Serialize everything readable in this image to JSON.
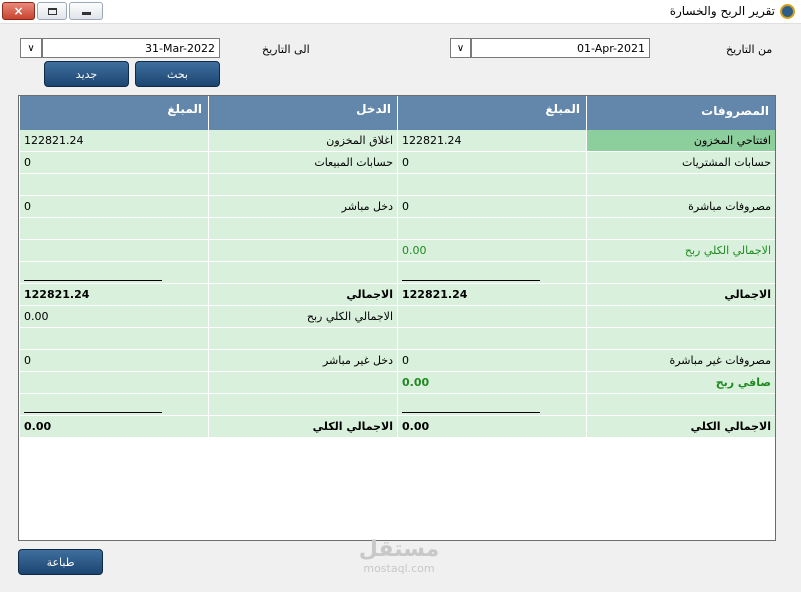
{
  "window": {
    "title": "تقرير الربح والخسارة",
    "close_glyph": "×"
  },
  "filters": {
    "from_label": "من التاريخ",
    "from_value": "01-Apr-2021",
    "to_label": "الى التاريخ",
    "to_value": "31-Mar-2022",
    "from_chevron": "∨",
    "to_chevron": "∨"
  },
  "buttons": {
    "search": "بحث",
    "new": "جديد",
    "print": "طباعة"
  },
  "table": {
    "headers": [
      "المصروفات",
      "المبلغ",
      "الدخل",
      "المبلغ"
    ],
    "rows": [
      [
        "افتتاحي المخزون",
        "122821.24",
        "اغلاق المخزون",
        "122821.24"
      ],
      [
        "حسابات المشتريات",
        "0",
        "حسابات المبيعات",
        "0"
      ],
      [
        "",
        "",
        "",
        ""
      ],
      [
        "مصروفات مباشرة",
        "0",
        "دخل مباشر",
        "0"
      ],
      [
        "",
        "",
        "",
        ""
      ],
      [
        "الاجمالي الكلي ربح",
        "0.00",
        "",
        ""
      ],
      [
        "",
        "",
        "",
        ""
      ],
      [
        "الاجمالي",
        "122821.24",
        "الاجمالي",
        "122821.24"
      ],
      [
        "",
        "",
        "الاجمالي الكلي ربح",
        "0.00"
      ],
      [
        "",
        "",
        "",
        ""
      ],
      [
        "مصروفات غير مباشرة",
        "0",
        "دخل غير مباشر",
        "0"
      ],
      [
        "صافي ربح",
        "0.00",
        "",
        ""
      ],
      [
        "",
        "",
        "",
        ""
      ],
      [
        "الاجمالي الكلي",
        "0.00",
        "الاجمالي الكلي",
        "0.00"
      ]
    ]
  },
  "watermark": {
    "logo": "مستقل",
    "site": "mostaql.com"
  }
}
